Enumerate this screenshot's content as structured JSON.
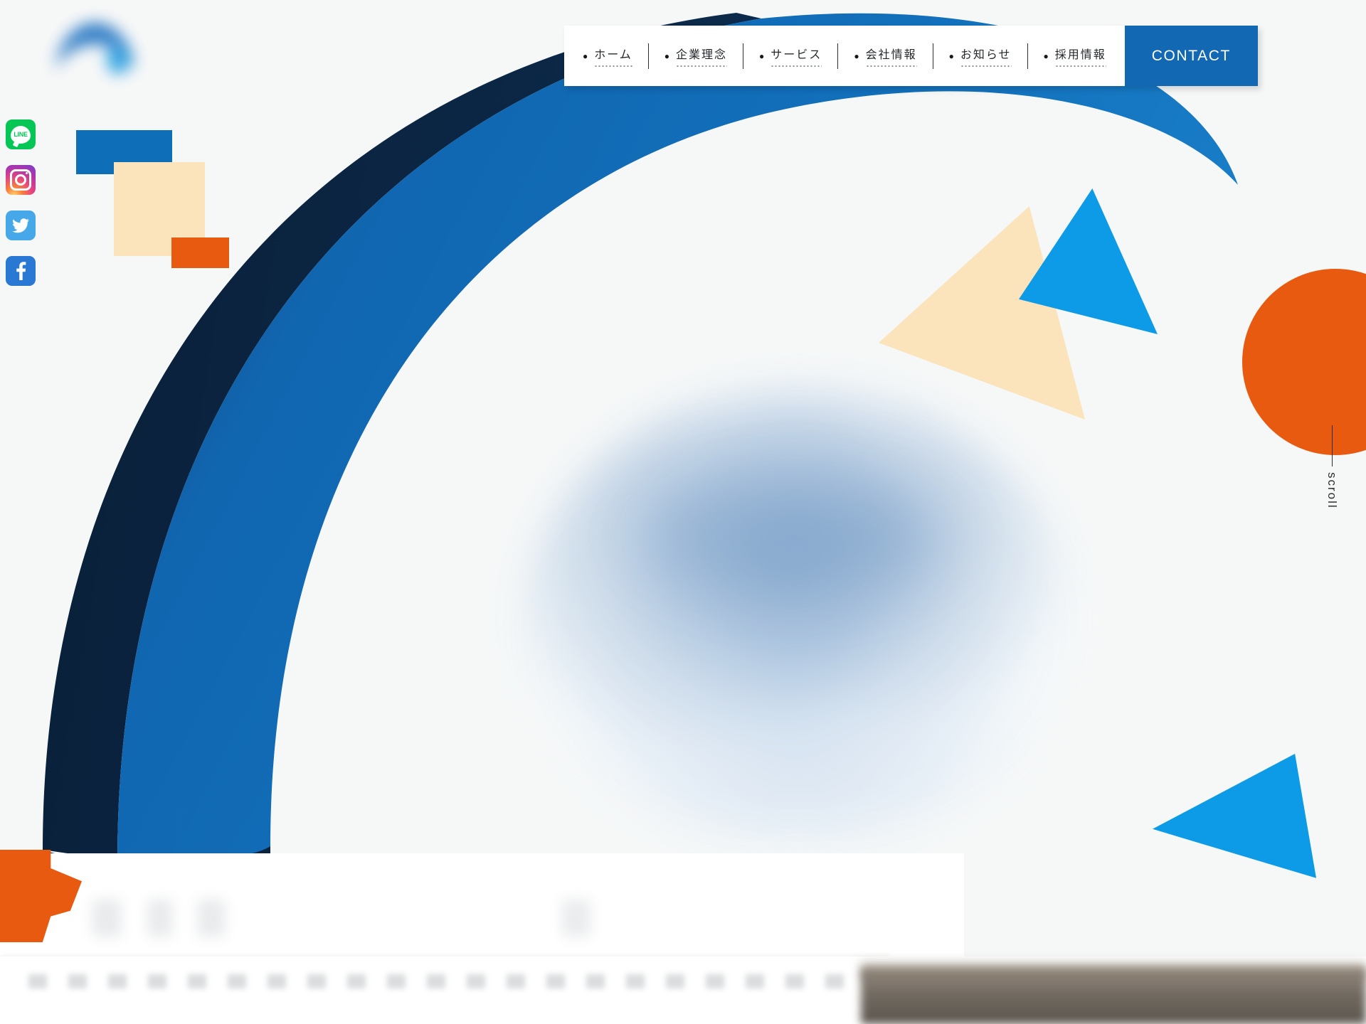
{
  "site": {
    "background_color": "#f6f8f8",
    "brand_blue": "#1268b3",
    "brand_blue_dark": "#0b2746",
    "accent_light_blue": "#0d9ae6",
    "accent_orange": "#e85a10",
    "accent_cream": "#fbe3bb"
  },
  "logo": {
    "name": "site-logo",
    "state": "blurred"
  },
  "social": {
    "items": [
      {
        "name": "line",
        "icon": "line-icon",
        "label": "LINE",
        "color": "#06c755"
      },
      {
        "name": "instagram",
        "icon": "instagram-icon",
        "label": "Instagram",
        "color": "#e8457f"
      },
      {
        "name": "twitter",
        "icon": "twitter-icon",
        "label": "Twitter",
        "color": "#46a8e8"
      },
      {
        "name": "facebook",
        "icon": "facebook-icon",
        "label": "Facebook",
        "color": "#2878d4"
      }
    ]
  },
  "nav": {
    "bullet": "●",
    "items": [
      {
        "label": "ホーム"
      },
      {
        "label": "企業理念"
      },
      {
        "label": "サービス"
      },
      {
        "label": "会社情報"
      },
      {
        "label": "お知らせ"
      },
      {
        "label": "採用情報"
      }
    ],
    "contact_label": "CONTACT"
  },
  "hero": {
    "scroll_label": "scroll",
    "image_state": "blurred",
    "headline_state": "blurred",
    "subcopy_state": "blurred"
  },
  "shapes": [
    {
      "name": "square-blue",
      "color": "#0e6eb8"
    },
    {
      "name": "square-cream",
      "color": "#fbe3bb"
    },
    {
      "name": "square-orange",
      "color": "#e85a10"
    },
    {
      "name": "triangle-blue-top",
      "color": "#0d9ae6"
    },
    {
      "name": "triangle-cream",
      "color": "#fbe3bb"
    },
    {
      "name": "triangle-blue-bottom",
      "color": "#0d9ae6"
    },
    {
      "name": "circle-orange",
      "color": "#e85a10"
    },
    {
      "name": "puzzle-orange",
      "color": "#e85a10"
    }
  ]
}
